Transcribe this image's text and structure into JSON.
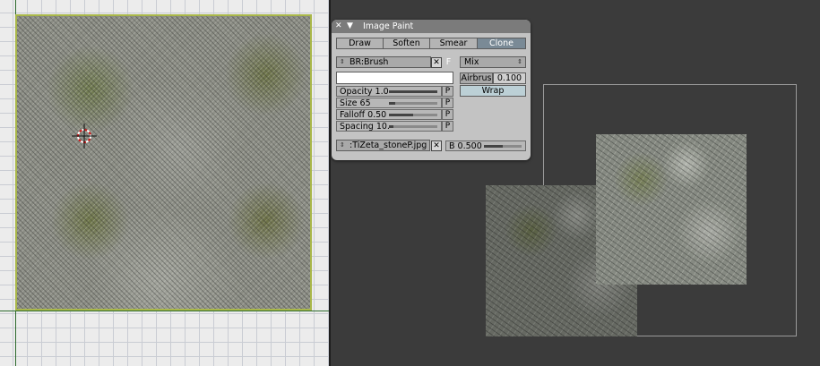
{
  "image_paint_panel": {
    "title": "Image Paint",
    "tools": [
      {
        "label": "Draw",
        "active": false
      },
      {
        "label": "Soften",
        "active": false
      },
      {
        "label": "Smear",
        "active": false
      },
      {
        "label": "Clone",
        "active": true
      }
    ],
    "brush": {
      "name": "BR:Brush",
      "fake_user_label": "F"
    },
    "blend_mode": "Mix",
    "airbrush": {
      "label": "Airbrus",
      "value": "0.100"
    },
    "wrap_label": "Wrap",
    "sliders": {
      "opacity": {
        "label": "Opacity 1.0",
        "level": 1.0
      },
      "size": {
        "label": "Size 65",
        "level": 0.13
      },
      "falloff": {
        "label": "Falloff 0.50",
        "level": 0.5
      },
      "spacing": {
        "label": "Spacing 10.",
        "level": 0.1
      }
    },
    "pressure_label": "P",
    "clone_image": {
      "name": ":TiZeta_stoneP.jpg"
    },
    "clone_blend": {
      "label": "B 0.500",
      "level": 0.5
    }
  },
  "icons": {
    "close": "close-icon",
    "collapse": "triangle-down-icon",
    "browse": "spinner-arrows-icon",
    "remove": "x-icon",
    "cursor": "crosshair-cursor-icon"
  },
  "colors": {
    "grid": "#c9ccd3",
    "uv_border": "#a9b74a",
    "active_button": "#7a8a96",
    "viewport_bg": "#3b3b3b"
  }
}
